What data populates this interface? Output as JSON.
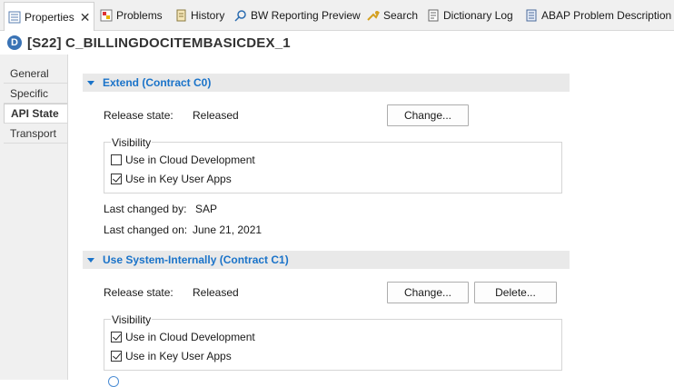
{
  "tabs": [
    {
      "label": "Properties",
      "icon": "properties-icon",
      "active": true
    },
    {
      "label": "Problems",
      "icon": "problems-icon"
    },
    {
      "label": "History",
      "icon": "history-icon"
    },
    {
      "label": "BW Reporting Preview",
      "icon": "bw-preview-icon"
    },
    {
      "label": "Search",
      "icon": "search-icon"
    },
    {
      "label": "Dictionary Log",
      "icon": "dictionary-log-icon"
    },
    {
      "label": "ABAP Problem Description",
      "icon": "abap-problem-icon"
    }
  ],
  "header": {
    "title": "[S22] C_BILLINGDOCITEMBASICDEX_1",
    "icon_letter": "D"
  },
  "nav": {
    "items": [
      "General",
      "Specific",
      "API State",
      "Transport"
    ],
    "selected": "API State"
  },
  "section1": {
    "title": "Extend (Contract C0)",
    "release_label": "Release state:",
    "release_value": "Released",
    "change_button": "Change...",
    "visibility_title": "Visibility",
    "cb_cloud": {
      "label": "Use in Cloud Development",
      "checked": false
    },
    "cb_keyuser": {
      "label": "Use in Key User Apps",
      "checked": true
    },
    "changed_by_label": "Last changed by:",
    "changed_by_value": "SAP",
    "changed_on_label": "Last changed on:",
    "changed_on_value": "June 21, 2021"
  },
  "section2": {
    "title": "Use System-Internally (Contract C1)",
    "release_label": "Release state:",
    "release_value": "Released",
    "change_button": "Change...",
    "delete_button": "Delete...",
    "visibility_title": "Visibility",
    "cb_cloud": {
      "label": "Use in Cloud Development",
      "checked": true
    },
    "cb_keyuser": {
      "label": "Use in Key User Apps",
      "checked": true
    }
  },
  "colors": {
    "accent": "#1a73c9",
    "section_bg": "#e9e9e9",
    "nav_bg": "#f0f0f0"
  }
}
